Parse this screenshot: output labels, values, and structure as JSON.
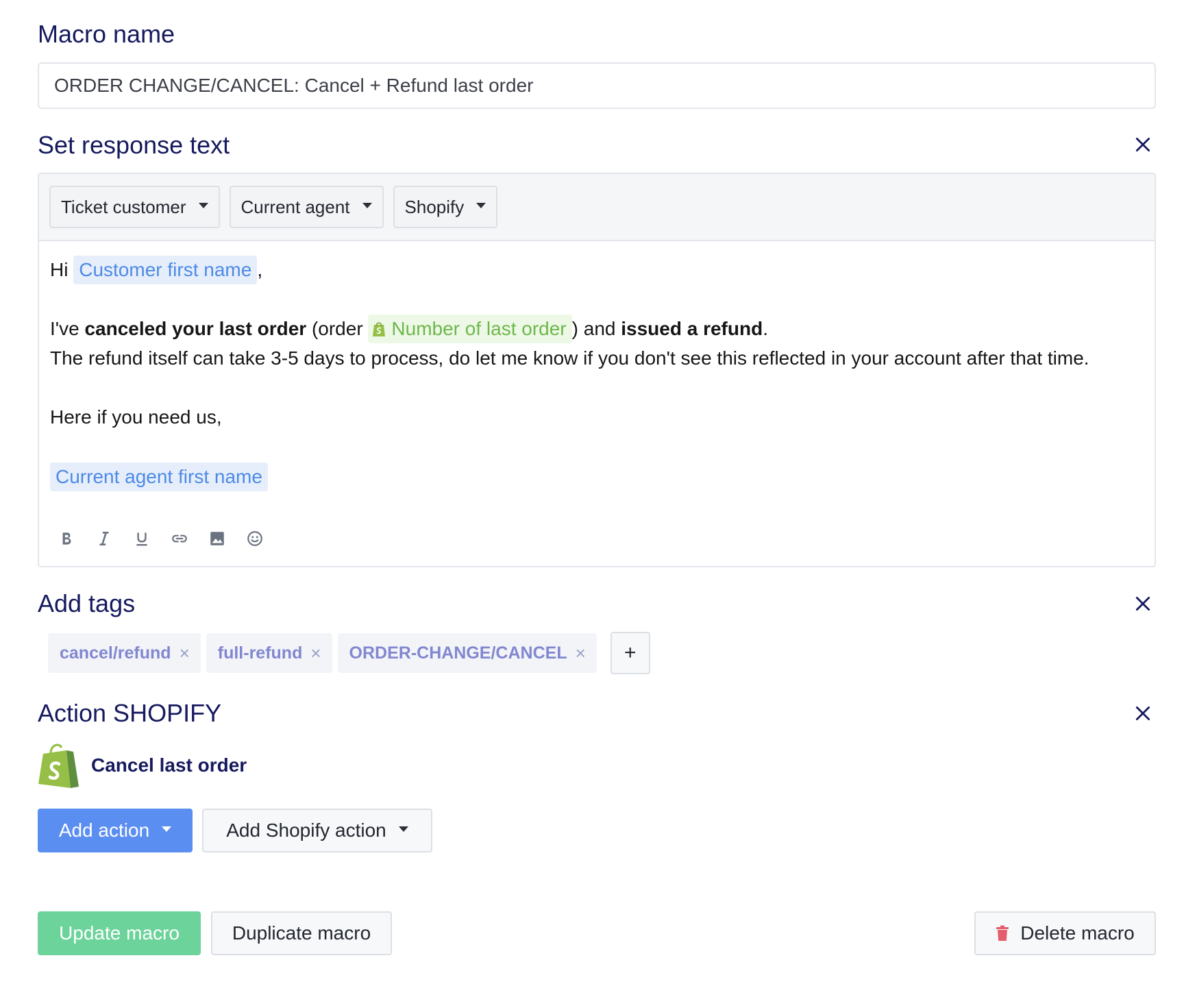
{
  "macro_name": {
    "label": "Macro name",
    "value": "ORDER CHANGE/CANCEL: Cancel + Refund last order"
  },
  "response": {
    "title": "Set response text",
    "variable_menus": [
      "Ticket customer",
      "Current agent",
      "Shopify"
    ],
    "body": {
      "greeting": "Hi",
      "customer_var": "Customer first name",
      "comma": ",",
      "l2_a": "I've ",
      "l2_b": "canceled your last order",
      "l2_c": " (order ",
      "order_var": "Number of last order",
      "l2_d": ") and ",
      "l2_e": "issued a refund",
      "l2_f": ".",
      "l3": "The refund itself can take 3-5 days to process, do let me know if you don't see this reflected in your account after that time.",
      "l4": "Here if you need us,",
      "agent_var": "Current agent first name"
    },
    "format_icons": [
      "bold-icon",
      "italic-icon",
      "underline-icon",
      "link-icon",
      "image-icon",
      "emoji-icon"
    ]
  },
  "tags": {
    "title": "Add tags",
    "items": [
      "cancel/refund",
      "full-refund",
      "ORDER-CHANGE/CANCEL"
    ],
    "remove_glyph": "×",
    "add_glyph": "+"
  },
  "shopify_action": {
    "title": "Action SHOPIFY",
    "action_label": "Cancel last order",
    "add_action": "Add action",
    "add_shopify_action": "Add Shopify action"
  },
  "footer": {
    "update": "Update macro",
    "duplicate": "Duplicate macro",
    "delete": "Delete macro"
  },
  "colors": {
    "title": "#161a5e",
    "primary": "#5b8ef1",
    "success": "#6cd39a",
    "shopify_green": "#95bf47",
    "delete_icon": "#e35d6a"
  }
}
